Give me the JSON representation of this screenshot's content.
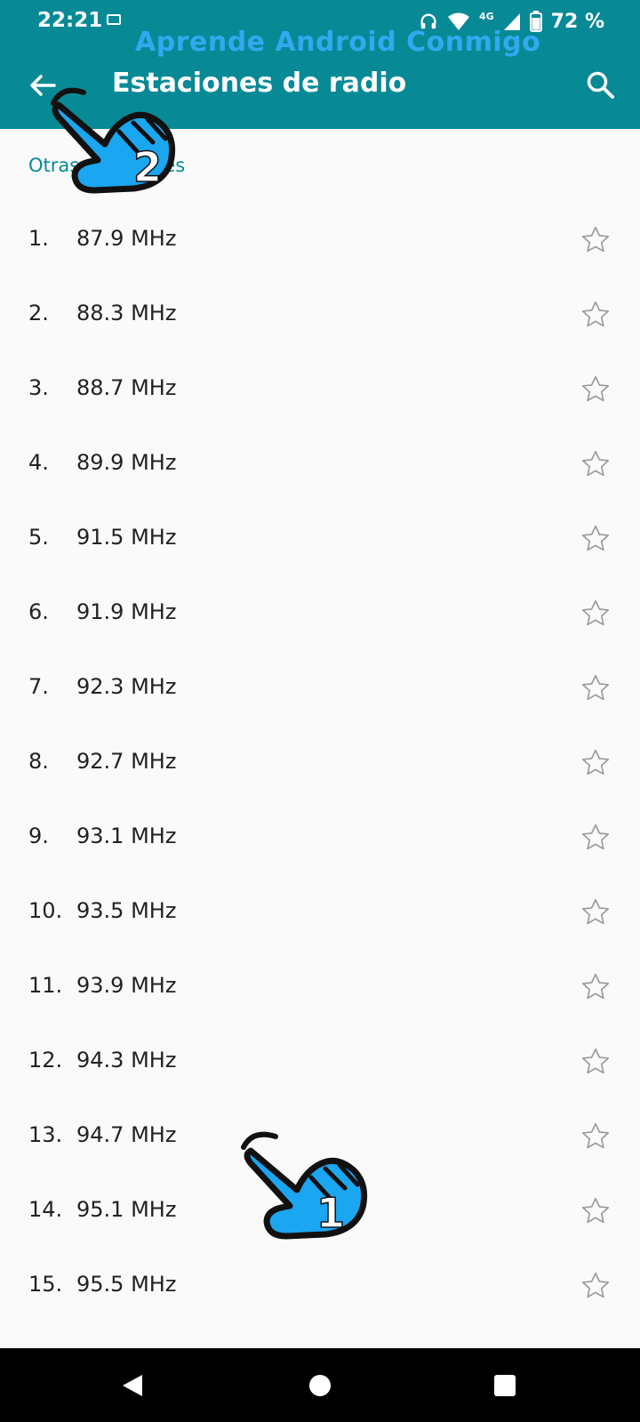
{
  "status_bar": {
    "time": "22:21",
    "network": "4G",
    "battery": "72 %"
  },
  "watermark": "Aprende Android Conmigo",
  "toolbar": {
    "title": "Estaciones de radio",
    "back_icon": "arrow-left-icon",
    "search_icon": "search-icon"
  },
  "section": {
    "header": "Otras estaciones"
  },
  "stations": [
    {
      "index": "1.",
      "freq": "87.9 MHz"
    },
    {
      "index": "2.",
      "freq": "88.3 MHz"
    },
    {
      "index": "3.",
      "freq": "88.7 MHz"
    },
    {
      "index": "4.",
      "freq": "89.9 MHz"
    },
    {
      "index": "5.",
      "freq": "91.5 MHz"
    },
    {
      "index": "6.",
      "freq": "91.9 MHz"
    },
    {
      "index": "7.",
      "freq": "92.3 MHz"
    },
    {
      "index": "8.",
      "freq": "92.7 MHz"
    },
    {
      "index": "9.",
      "freq": "93.1 MHz"
    },
    {
      "index": "10.",
      "freq": "93.5 MHz"
    },
    {
      "index": "11.",
      "freq": "93.9 MHz"
    },
    {
      "index": "12.",
      "freq": "94.3 MHz"
    },
    {
      "index": "13.",
      "freq": "94.7 MHz"
    },
    {
      "index": "14.",
      "freq": "95.1 MHz"
    },
    {
      "index": "15.",
      "freq": "95.5 MHz"
    }
  ],
  "annotations": {
    "hand_1_label": "1",
    "hand_2_label": "2"
  },
  "colors": {
    "appbar": "#078a96",
    "accent": "#078a96",
    "watermark": "#33a8ee",
    "hand_fill": "#1aa6f0"
  }
}
